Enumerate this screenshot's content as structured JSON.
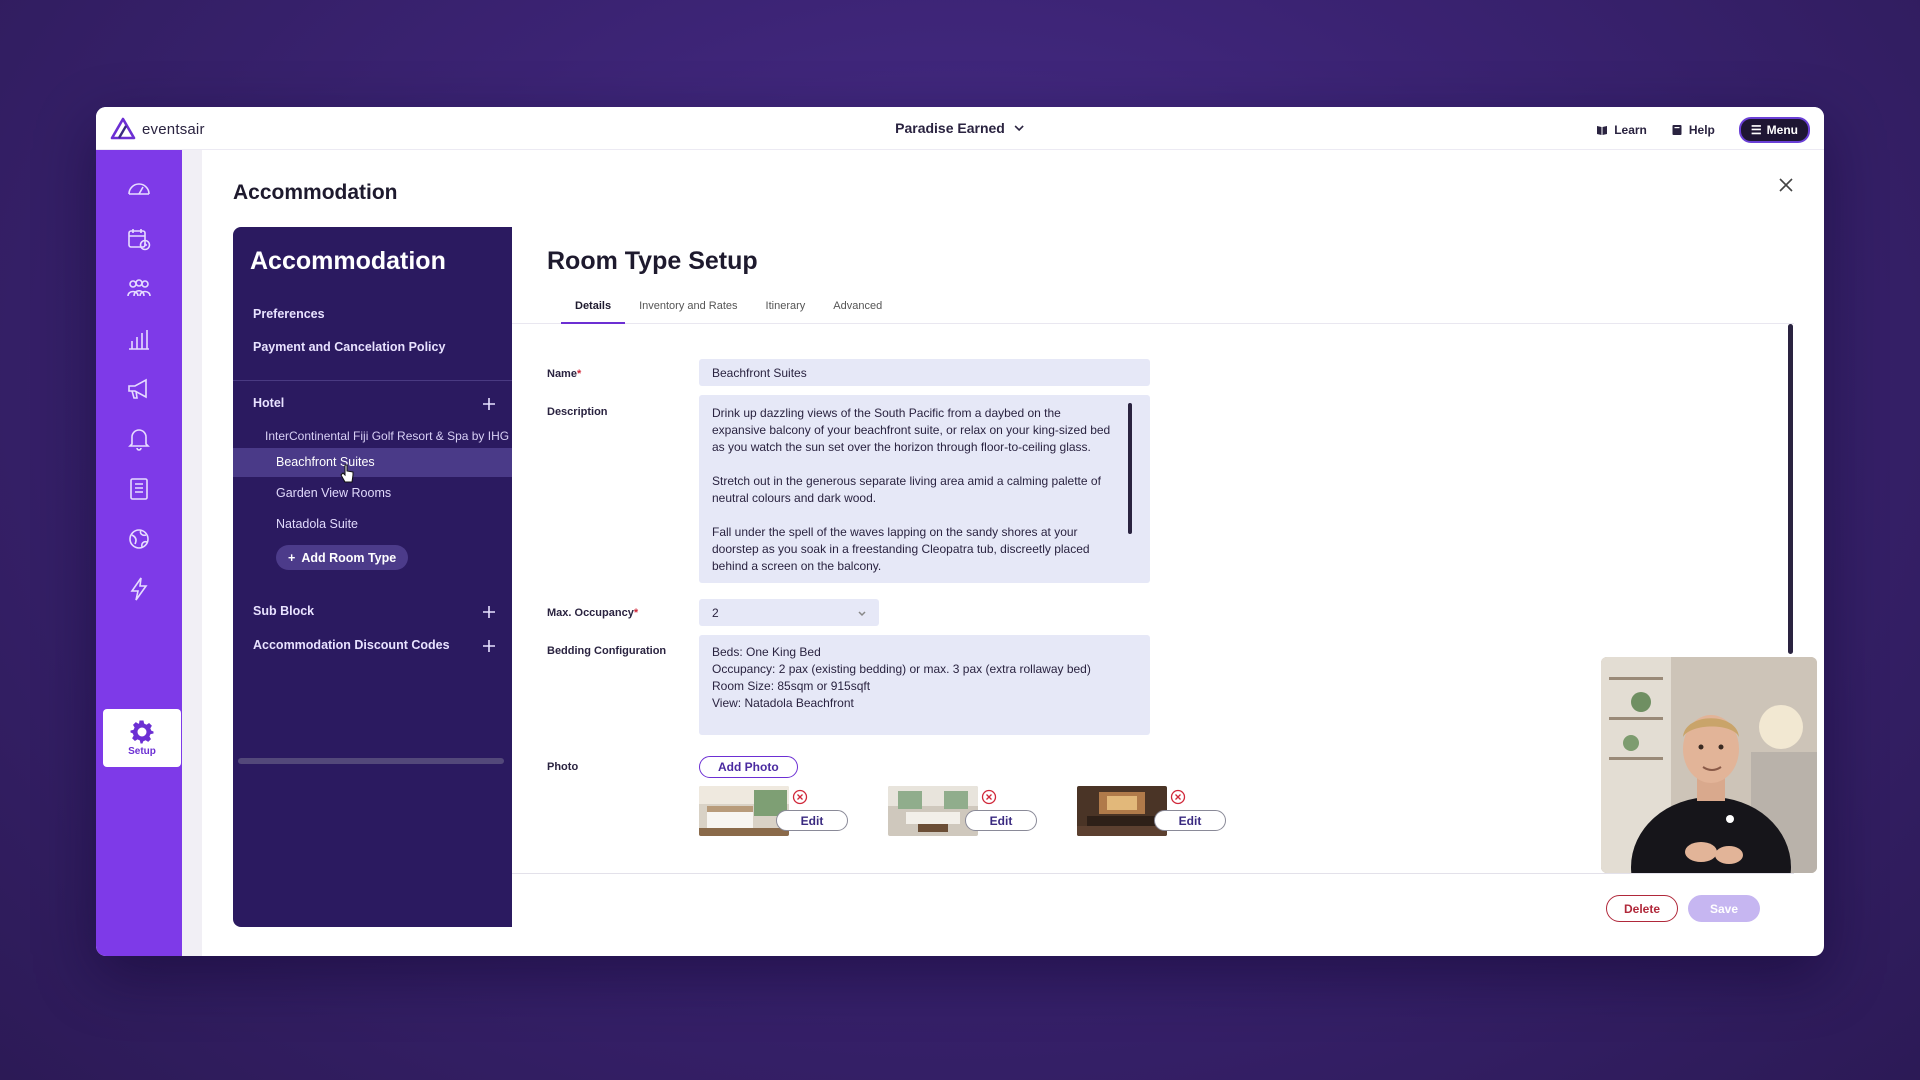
{
  "topbar": {
    "logo_text": "eventsair",
    "event_name": "Paradise Earned",
    "learn_label": "Learn",
    "help_label": "Help",
    "menu_label": "Menu"
  },
  "rail": {
    "items": [
      "dashboard-icon",
      "calendar-icon",
      "people-icon",
      "reports-icon",
      "megaphone-icon",
      "bell-icon",
      "document-icon",
      "globe-icon",
      "lightning-icon"
    ],
    "active_label": "Setup"
  },
  "page": {
    "title": "Accommodation"
  },
  "panel": {
    "title": "Accommodation",
    "preferences": "Preferences",
    "payment_policy": "Payment and Cancelation Policy",
    "hotel_section": "Hotel",
    "hotel_name": "InterContinental Fiji Golf Resort & Spa by IHG",
    "room_types": [
      "Beachfront Suites",
      "Garden View Rooms",
      "Natadola Suite"
    ],
    "add_room_type": "Add Room Type",
    "sub_block": "Sub Block",
    "discount_codes": "Accommodation Discount Codes"
  },
  "form": {
    "title": "Room Type Setup",
    "tabs": [
      "Details",
      "Inventory and Rates",
      "Itinerary",
      "Advanced"
    ],
    "name_label": "Name",
    "name_value": "Beachfront Suites",
    "description_label": "Description",
    "description_paragraphs": [
      "Drink up dazzling views of the South Pacific from a daybed on the\nexpansive balcony of your beachfront suite, or relax on your king-sized bed\nas you watch the sun set over the horizon through floor-to-ceiling glass.",
      "Stretch out in the generous separate living area amid a calming palette of\nneutral colours and dark wood.",
      "Fall under the spell of the waves lapping on the sandy shores at your\ndoorstep as you soak in a freestanding Cleopatra tub, discreetly placed\nbehind a screen on the balcony."
    ],
    "max_occupancy_label": "Max. Occupancy",
    "max_occupancy_value": "2",
    "bedding_label": "Bedding Configuration",
    "bedding_lines": [
      "Beds: One King Bed",
      "Occupancy: 2 pax (existing bedding) or max. 3 pax (extra rollaway bed)",
      "Room Size: 85sqm or 915sqft",
      "View: Natadola Beachfront"
    ],
    "photo_label": "Photo",
    "add_photo": "Add Photo",
    "edit_label": "Edit",
    "delete_label": "Delete",
    "save_label": "Save"
  },
  "colors": {
    "accent": "#6c2fd3",
    "rail": "#7e3ae8",
    "panel": "#2b1a60",
    "field": "#e6e8f7",
    "delete": "#b0283a",
    "save_disabled": "#c6b6f1"
  }
}
